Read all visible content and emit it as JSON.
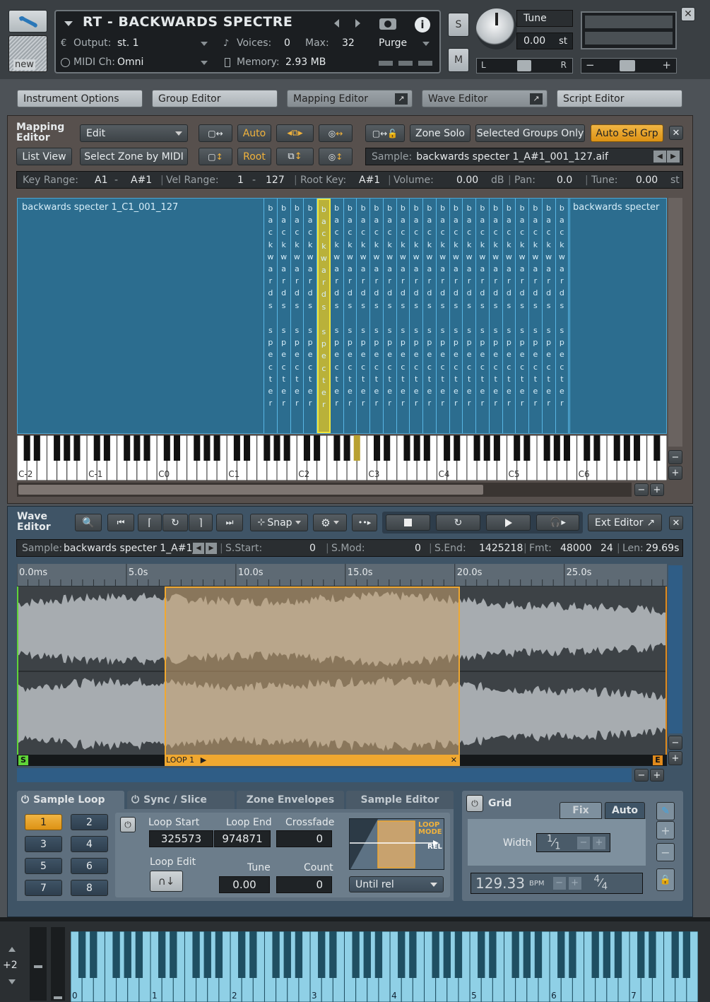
{
  "header": {
    "instrument_name": "RT - BACKWARDS SPECTRE",
    "output_label": "Output:",
    "output_value": "st. 1",
    "voices_label": "Voices:",
    "voices_value": "0",
    "max_label": "Max:",
    "max_value": "32",
    "purge_label": "Purge",
    "midi_label": "MIDI Ch:",
    "midi_value": "Omni",
    "memory_label": "Memory:",
    "memory_value": "2.93 MB",
    "new_label": "new",
    "s_label": "S",
    "m_label": "M",
    "tune_label": "Tune",
    "tune_value": "0.00",
    "tune_unit": "st",
    "pan_left": "L",
    "pan_right": "R"
  },
  "editor_tabs": [
    {
      "label": "Instrument Options"
    },
    {
      "label": "Group Editor"
    },
    {
      "label": "Mapping Editor"
    },
    {
      "label": "Wave Editor"
    },
    {
      "label": "Script Editor"
    }
  ],
  "mapping": {
    "title": "Mapping Editor",
    "edit_label": "Edit",
    "auto_label": "Auto",
    "root_label": "Root",
    "list_view": "List View",
    "select_zone_midi": "Select Zone by MIDI",
    "zone_solo": "Zone Solo",
    "selected_groups_only": "Selected Groups Only",
    "auto_sel_grp": "Auto Sel Grp",
    "sample_label": "Sample:",
    "sample_value": "backwards specter 1_A#1_001_127.aif",
    "key_range_label": "Key Range:",
    "key_range_from": "A1",
    "key_range_dash": "-",
    "key_range_to": "A#1",
    "vel_range_label": "Vel Range:",
    "vel_from": "1",
    "vel_dash": "-",
    "vel_to": "127",
    "root_key_label": "Root Key:",
    "root_key_value": "A#1",
    "volume_label": "Volume:",
    "volume_value": "0.00",
    "volume_unit": "dB",
    "pan_label": "Pan:",
    "pan_value": "0.0",
    "tune_label": "Tune:",
    "tune_value": "0.00",
    "tune_unit": "st",
    "zone_left_name": "backwards specter 1_C1_001_127",
    "zone_right_name": "backwards specter",
    "zone_vert_top": "backwards",
    "zone_vert_bottom": "specter",
    "octave_labels": [
      "C-2",
      "C-1",
      "C0",
      "C1",
      "C2",
      "C3",
      "C4",
      "C5",
      "C6"
    ]
  },
  "wave": {
    "title": "Wave Editor",
    "snap_label": "Snap",
    "ext_editor": "Ext Editor",
    "sample_label": "Sample:",
    "sample_value": "backwards specter 1_A#1_",
    "sstart_label": "S.Start:",
    "sstart_value": "0",
    "smod_label": "S.Mod:",
    "smod_value": "0",
    "send_label": "S.End:",
    "send_value": "1425218",
    "fmt_label": "Fmt:",
    "fmt_value": "48000",
    "fmt_bits": "24",
    "len_label": "Len:",
    "len_value": "29.69s",
    "ruler": [
      "0.0ms",
      "5.0s",
      "10.0s",
      "15.0s",
      "20.0s",
      "25.0s"
    ],
    "loop_label": "LOOP 1",
    "s_marker": "S",
    "e_marker": "E"
  },
  "bottom_tabs": [
    {
      "label": "Sample Loop"
    },
    {
      "label": "Sync / Slice"
    },
    {
      "label": "Zone Envelopes"
    },
    {
      "label": "Sample Editor"
    }
  ],
  "loop": {
    "slots": [
      "1",
      "2",
      "3",
      "4",
      "5",
      "6",
      "7",
      "8"
    ],
    "loop_start_label": "Loop Start",
    "loop_start_value": "325573",
    "loop_end_label": "Loop End",
    "loop_end_value": "974871",
    "crossfade_label": "Crossfade",
    "crossfade_value": "0",
    "loop_edit_label": "Loop Edit",
    "tune_label": "Tune",
    "tune_value": "0.00",
    "count_label": "Count",
    "count_value": "0",
    "mode_label_1": "LOOP",
    "mode_label_2": "MODE",
    "rel_label": "REL",
    "until_rel": "Until rel"
  },
  "grid": {
    "title": "Grid",
    "fix_label": "Fix",
    "auto_label": "Auto",
    "width_label": "Width",
    "width_num": "1",
    "width_den": "1",
    "bpm_value": "129.33",
    "bpm_unit": "BPM",
    "sig_num": "4",
    "sig_den": "4"
  },
  "keyboard": {
    "octave_shift": "+2",
    "octaves": [
      "0",
      "1",
      "2",
      "3",
      "4",
      "5",
      "6",
      "7"
    ]
  },
  "colors": {
    "zone_fill": "#2c6d8f",
    "zone_selected": "#f1e43a",
    "accent_orange": "#f0a830",
    "loop_region": "#c8a26e"
  }
}
